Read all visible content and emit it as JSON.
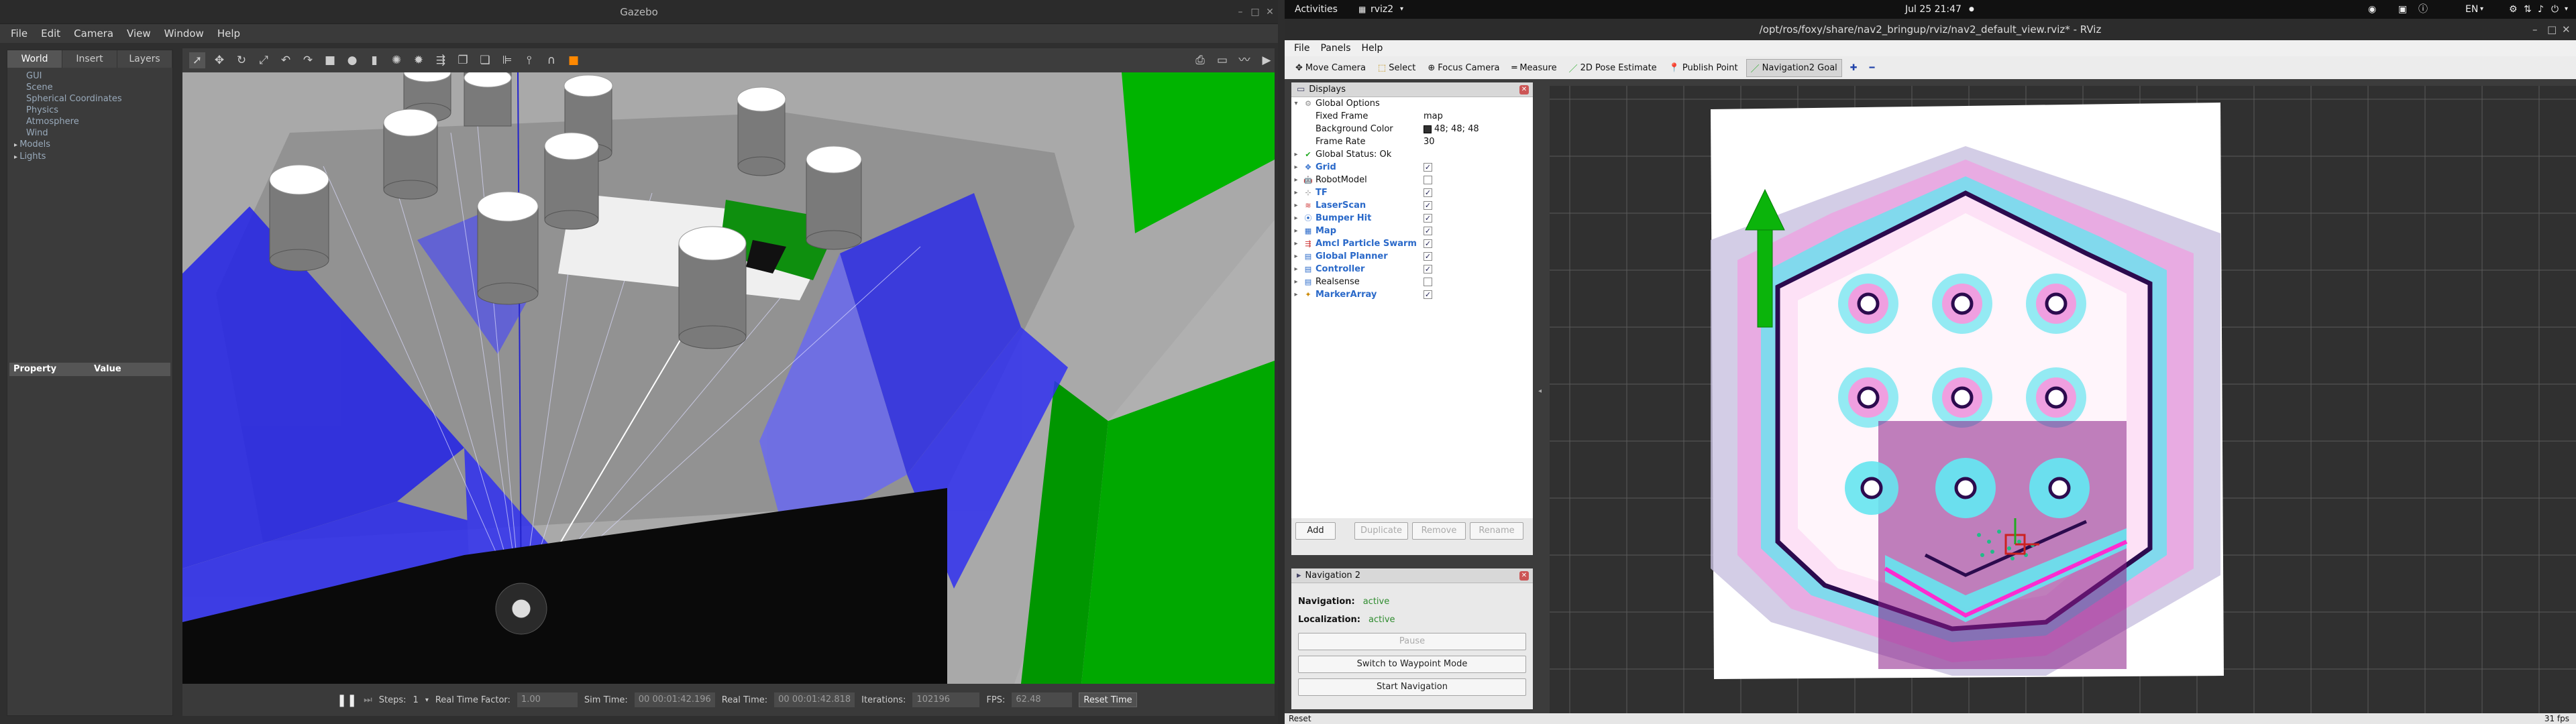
{
  "gazebo": {
    "title": "Gazebo",
    "menu": [
      "File",
      "Edit",
      "Camera",
      "View",
      "Window",
      "Help"
    ],
    "tabs": [
      "World",
      "Insert",
      "Layers"
    ],
    "tree": [
      "GUI",
      "Scene",
      "Spherical Coordinates",
      "Physics",
      "Atmosphere",
      "Wind",
      "Models",
      "Lights"
    ],
    "prop_head": [
      "Property",
      "Value"
    ],
    "bottom": {
      "steps_label": "Steps:",
      "steps": "1",
      "rtf_label": "Real Time Factor:",
      "rtf": "1.00",
      "sim_label": "Sim Time:",
      "sim": "00 00:01:42.196",
      "real_label": "Real Time:",
      "real": "00 00:01:42.818",
      "iter_label": "Iterations:",
      "iter": "102196",
      "fps_label": "FPS:",
      "fps": "62.48",
      "reset": "Reset Time"
    }
  },
  "topbar": {
    "activities": "Activities",
    "app": "rviz2",
    "clock": "Jul 25  21:47",
    "lang": "EN"
  },
  "rviz": {
    "title": "/opt/ros/foxy/share/nav2_bringup/rviz/nav2_default_view.rviz* - RViz",
    "menu": [
      "File",
      "Panels",
      "Help"
    ],
    "tools": [
      "Move Camera",
      "Select",
      "Focus Camera",
      "Measure",
      "2D Pose Estimate",
      "Publish Point",
      "Navigation2 Goal"
    ],
    "displays_title": "Displays",
    "global": {
      "label": "Global Options",
      "fixed_frame": "Fixed Frame",
      "fixed_val": "map",
      "bg": "Background Color",
      "bg_val": "48; 48; 48",
      "rate": "Frame Rate",
      "rate_val": "30",
      "status": "Global Status: Ok"
    },
    "displays": [
      {
        "name": "Grid",
        "checked": true,
        "color": "blue"
      },
      {
        "name": "RobotModel",
        "checked": false,
        "color": "plain"
      },
      {
        "name": "TF",
        "checked": true,
        "color": "blue"
      },
      {
        "name": "LaserScan",
        "checked": true,
        "color": "blue"
      },
      {
        "name": "Bumper Hit",
        "checked": true,
        "color": "blue"
      },
      {
        "name": "Map",
        "checked": true,
        "color": "blue"
      },
      {
        "name": "Amcl Particle Swarm",
        "checked": true,
        "color": "blue"
      },
      {
        "name": "Global Planner",
        "checked": true,
        "color": "blue"
      },
      {
        "name": "Controller",
        "checked": true,
        "color": "blue"
      },
      {
        "name": "Realsense",
        "checked": false,
        "color": "plain"
      },
      {
        "name": "MarkerArray",
        "checked": true,
        "color": "blue"
      }
    ],
    "buttons": [
      "Add",
      "Duplicate",
      "Remove",
      "Rename"
    ],
    "nav": {
      "title": "Navigation 2",
      "navigation": "Navigation:",
      "nav_val": "active",
      "localization": "Localization:",
      "loc_val": "active",
      "pause": "Pause",
      "waypoint": "Switch to Waypoint Mode",
      "start": "Start Navigation"
    },
    "status": {
      "reset": "Reset",
      "fps": "31 fps"
    }
  }
}
